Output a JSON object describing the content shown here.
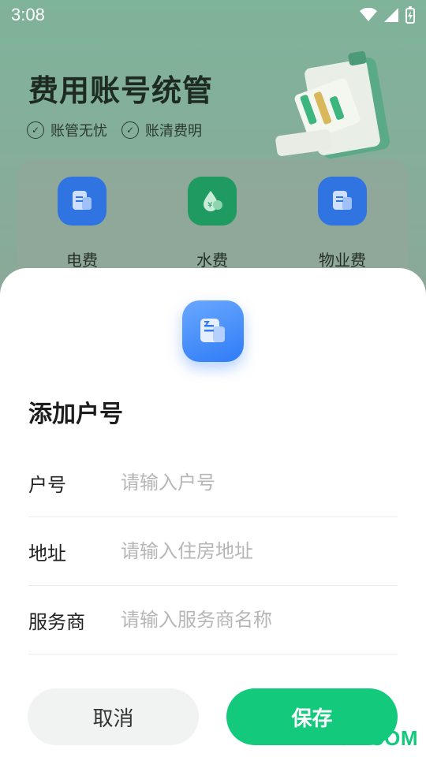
{
  "status_bar": {
    "time": "3:08"
  },
  "background": {
    "hero_title": "费用账号统管",
    "tags": [
      "账管无忧",
      "账清费明"
    ],
    "services": [
      {
        "label": "电费",
        "icon": "bill-doc-icon",
        "color": "#2f74e0"
      },
      {
        "label": "水费",
        "icon": "water-drop-yuan-icon",
        "color": "#1f9a60"
      },
      {
        "label": "物业费",
        "icon": "bill-doc-icon",
        "color": "#2f74e0"
      }
    ]
  },
  "dialog": {
    "icon": "bill-doc-icon",
    "title": "添加户号",
    "fields": [
      {
        "label": "户号",
        "placeholder": "请输入户号",
        "value": ""
      },
      {
        "label": "地址",
        "placeholder": "请输入住房地址",
        "value": ""
      },
      {
        "label": "服务商",
        "placeholder": "请输入服务商名称",
        "value": ""
      }
    ],
    "cancel_label": "取消",
    "save_label": "保存"
  },
  "watermark": "ITMOP.COM",
  "colors": {
    "accent": "#12c97c",
    "icon_blue": "#2f7cf6"
  }
}
